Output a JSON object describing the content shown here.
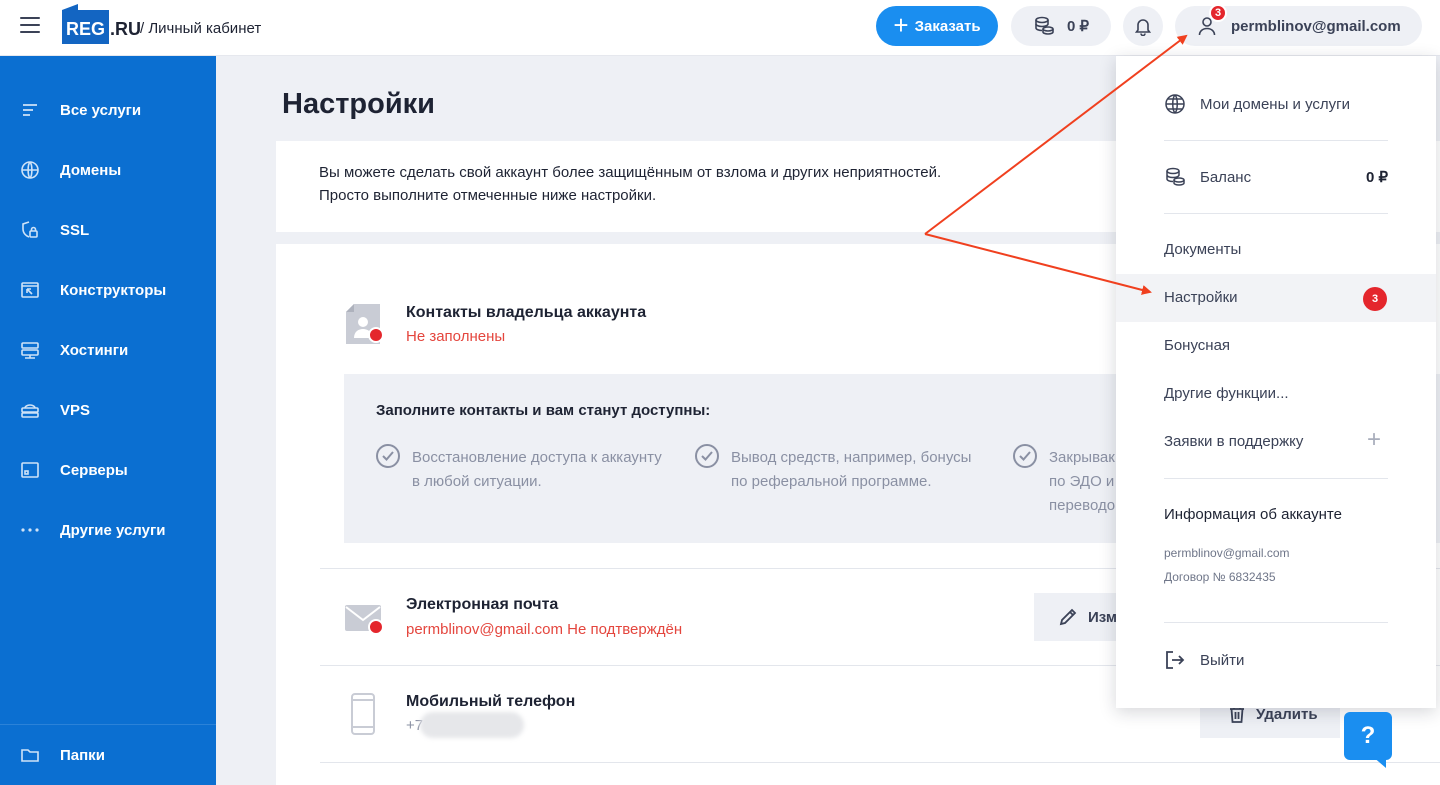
{
  "header": {
    "logo_box": "REG",
    "logo_ru": ".RU",
    "breadcrumb": "/ Личный кабинет",
    "order_label": "Заказать",
    "order_plus": "+",
    "balance": "0 ₽",
    "user_email": "permblinov@gmail.com",
    "user_badge": "3"
  },
  "sidebar": {
    "items": [
      {
        "label": "Все услуги",
        "icon": "list-icon"
      },
      {
        "label": "Домены",
        "icon": "globe-icon"
      },
      {
        "label": "SSL",
        "icon": "shield-lock-icon"
      },
      {
        "label": "Конструкторы",
        "icon": "builder-icon"
      },
      {
        "label": "Хостинги",
        "icon": "hosting-icon"
      },
      {
        "label": "VPS",
        "icon": "vps-icon"
      },
      {
        "label": "Серверы",
        "icon": "server-icon"
      },
      {
        "label": "Другие услуги",
        "icon": "dots-icon"
      }
    ],
    "folders": "Папки"
  },
  "main": {
    "title": "Настройки",
    "intro_line1": "Вы можете сделать свой аккаунт более защищённым от взлома и других неприятностей.",
    "intro_line2": "Просто выполните отмеченные ниже настройки.",
    "contacts": {
      "title": "Контакты владельца аккаунта",
      "status": "Не заполнены",
      "box_title": "Заполните контакты и вам станут доступны:",
      "features": [
        {
          "line1": "Восстановление доступа к аккаунту",
          "line2": "в любой ситуации."
        },
        {
          "line1": "Вывод средств, например, бонусы",
          "line2": "по реферальной программе."
        },
        {
          "line1": "Закрывак",
          "line2": "по ЭДО и",
          "line3": "переводо"
        }
      ]
    },
    "email": {
      "title": "Электронная почта",
      "status": "permblinov@gmail.com Не подтверждён",
      "button": "Изм"
    },
    "phone": {
      "title": "Мобильный телефон",
      "value": "+7",
      "button": "Удалить"
    }
  },
  "dropdown": {
    "domains": "Мои домены и услуги",
    "balance_label": "Баланс",
    "balance_value": "0 ₽",
    "documents": "Документы",
    "settings": "Настройки",
    "settings_badge": "3",
    "bonus": "Бонусная",
    "other": "Другие функции...",
    "support": "Заявки в поддержку",
    "support_plus": "+",
    "account_info": "Информация об аккаунте",
    "account_email": "permblinov@gmail.com",
    "contract": "Договор № 6832435",
    "logout": "Выйти"
  },
  "help_label": "?",
  "colors": {
    "brand_blue": "#0b6fd1",
    "accent": "#1a8ef0",
    "alert_red": "#e4262c",
    "annotation_arrow": "#f0401f"
  }
}
